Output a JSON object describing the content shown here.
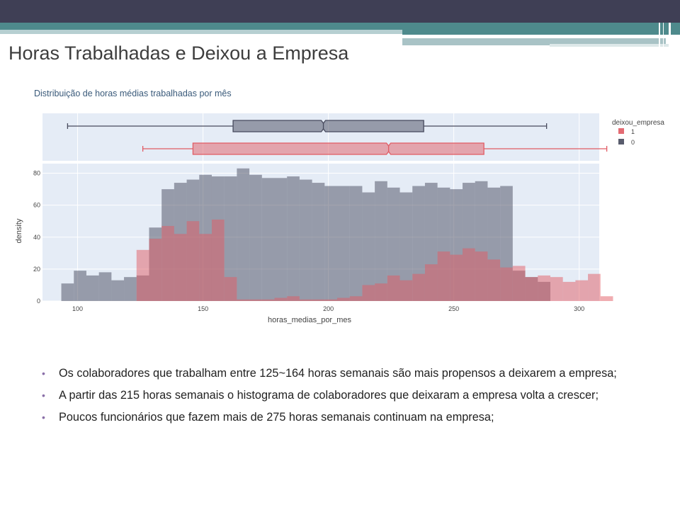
{
  "slide": {
    "title": "Horas Trabalhadas e Deixou a Empresa",
    "bullet_color": "#8a6fa8",
    "bullets": [
      "Os colaboradores que trabalham entre 125~164 horas semanais são mais propensos a deixarem a empresa;",
      "A partir das 215 horas semanais o histograma de colaboradores que deixaram a empresa volta a crescer;",
      "Poucos funcionários que fazem mais de 275 horas semanais continuam na empresa;"
    ]
  },
  "chart_data": {
    "type": "bar",
    "title": "Distribuição de horas médias trabalhadas por mês",
    "xlabel": "horas_medias_por_mes",
    "ylabel": "density",
    "xlim": [
      86,
      308
    ],
    "ylim": [
      0,
      86
    ],
    "xticks": [
      100,
      150,
      200,
      250,
      300
    ],
    "yticks": [
      0,
      20,
      40,
      60,
      80
    ],
    "bin_width": 5,
    "legend": {
      "title": "deixou_empresa",
      "position": "top-right"
    },
    "boxes": [
      {
        "name": "1",
        "color": "#e15b64",
        "min": 126,
        "q1": 146,
        "median": 224,
        "q3": 262,
        "max": 311
      },
      {
        "name": "0",
        "color": "#474a5d",
        "min": 96,
        "q1": 162,
        "median": 198,
        "q3": 238,
        "max": 287
      }
    ],
    "series": [
      {
        "name": "0",
        "color": "#474a5d",
        "x": [
          96,
          101,
          106,
          111,
          116,
          121,
          126,
          131,
          136,
          141,
          146,
          151,
          156,
          161,
          166,
          171,
          176,
          181,
          186,
          191,
          196,
          201,
          206,
          211,
          216,
          221,
          226,
          231,
          236,
          241,
          246,
          251,
          256,
          261,
          266,
          271,
          276,
          281,
          286
        ],
        "values": [
          11,
          19,
          16,
          18,
          13,
          15,
          16,
          46,
          70,
          74,
          76,
          79,
          78,
          78,
          83,
          79,
          77,
          77,
          78,
          76,
          74,
          72,
          72,
          72,
          68,
          75,
          71,
          68,
          72,
          74,
          71,
          70,
          74,
          75,
          71,
          72,
          19,
          15,
          12
        ]
      },
      {
        "name": "1",
        "color": "#e15b64",
        "x": [
          126,
          131,
          136,
          141,
          146,
          151,
          156,
          161,
          166,
          171,
          176,
          181,
          186,
          191,
          196,
          201,
          206,
          211,
          216,
          221,
          226,
          231,
          236,
          241,
          246,
          251,
          256,
          261,
          266,
          271,
          276,
          281,
          286,
          291,
          296,
          301,
          306,
          311
        ],
        "values": [
          32,
          39,
          47,
          42,
          50,
          42,
          51,
          15,
          1,
          1,
          1,
          2,
          3,
          1,
          1,
          1,
          2,
          3,
          10,
          11,
          16,
          13,
          17,
          23,
          31,
          29,
          33,
          31,
          26,
          21,
          22,
          15,
          16,
          15,
          12,
          13,
          17,
          3
        ]
      }
    ]
  }
}
